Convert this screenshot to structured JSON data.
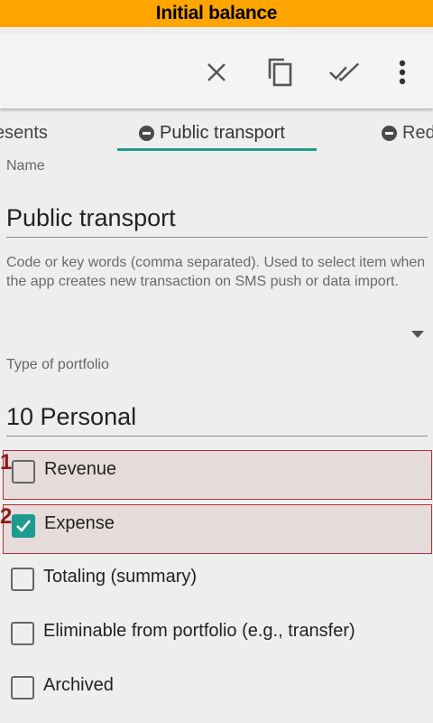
{
  "banner": {
    "title": "Initial balance"
  },
  "toolbar": {
    "icons": [
      "close-icon",
      "copy-icon",
      "done-all-icon",
      "more-vert-icon"
    ]
  },
  "tabs": [
    {
      "label": "esents",
      "icon": "minus-circle-icon"
    },
    {
      "label": "Public transport",
      "icon": "minus-circle-icon",
      "active": true
    },
    {
      "label": "Red",
      "icon": "minus-circle-icon"
    }
  ],
  "form": {
    "name_label": "Name",
    "name_value": "Public transport",
    "hint": "Code or key words (comma separated). Used to select item when the app creates new transaction on SMS push or data import.",
    "portfolio_label": "Type of portfolio",
    "portfolio_value": "10 Personal"
  },
  "checkboxes": [
    {
      "label": "Revenue",
      "checked": false,
      "marker": "1"
    },
    {
      "label": "Expense",
      "checked": true,
      "marker": "2"
    },
    {
      "label": "Totaling (summary)",
      "checked": false
    },
    {
      "label": "Eliminable from portfolio (e.g., transfer)",
      "checked": false
    },
    {
      "label": "Archived",
      "checked": false
    }
  ],
  "colors": {
    "banner": "#ffa500",
    "accent": "#1e9b8f",
    "highlight_border": "#b03030"
  }
}
